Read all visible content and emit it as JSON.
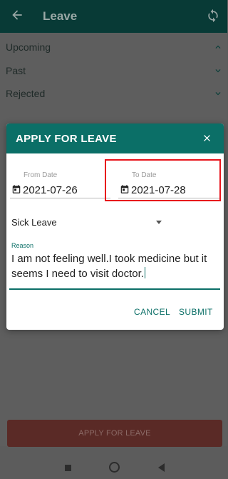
{
  "appbar": {
    "title": "Leave"
  },
  "sections": [
    {
      "label": "Upcoming",
      "state": "expanded"
    },
    {
      "label": "Past",
      "state": "collapsed"
    },
    {
      "label": "Rejected",
      "state": "collapsed"
    }
  ],
  "bottom_button": {
    "label": "APPLY FOR LEAVE"
  },
  "dialog": {
    "title": "APPLY FOR LEAVE",
    "from_date": {
      "label": "From Date",
      "value": "2021-07-26"
    },
    "to_date": {
      "label": "To Date",
      "value": "2021-07-28"
    },
    "leave_type": {
      "value": "Sick Leave"
    },
    "reason": {
      "label": "Reason",
      "value": "I am not feeling well.I took medicine but it seems I need to visit doctor."
    },
    "cancel_label": "CANCEL",
    "submit_label": "SUBMIT"
  },
  "icons": {
    "back": "arrow-left-icon",
    "refresh": "refresh-icon",
    "close": "close-icon",
    "calendar": "calendar-icon",
    "chevron_up": "chevron-up-icon",
    "chevron_down": "chevron-down-icon",
    "dropdown": "dropdown-arrow-icon"
  },
  "colors": {
    "primary": "#0b6f67",
    "appbar_dimmed": "#083a36",
    "apply_button_dimmed": "#5a2a26",
    "highlight": "#e8141c"
  }
}
